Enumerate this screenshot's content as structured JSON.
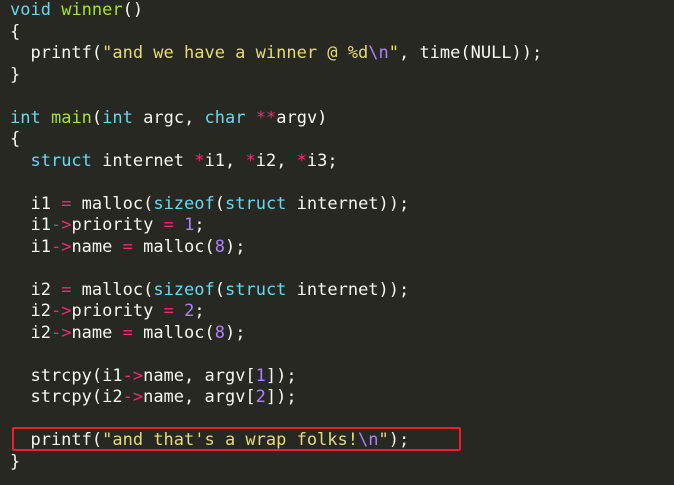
{
  "code_lines": [
    [
      [
        "kw",
        "void"
      ],
      [
        "plain",
        " "
      ],
      [
        "fn",
        "winner"
      ],
      [
        "plain",
        "()"
      ]
    ],
    [
      [
        "plain",
        "{"
      ]
    ],
    [
      [
        "plain",
        "  printf("
      ],
      [
        "str",
        "\"and we have a winner @ %d"
      ],
      [
        "esc",
        "\\n"
      ],
      [
        "str",
        "\""
      ],
      [
        "plain",
        ", time(NULL));"
      ]
    ],
    [
      [
        "plain",
        "}"
      ]
    ],
    [],
    [
      [
        "kw",
        "int"
      ],
      [
        "plain",
        " "
      ],
      [
        "fn",
        "main"
      ],
      [
        "plain",
        "("
      ],
      [
        "kw",
        "int"
      ],
      [
        "plain",
        " argc, "
      ],
      [
        "kw",
        "char"
      ],
      [
        "plain",
        " "
      ],
      [
        "op",
        "**"
      ],
      [
        "plain",
        "argv)"
      ]
    ],
    [
      [
        "plain",
        "{"
      ]
    ],
    [
      [
        "plain",
        "  "
      ],
      [
        "kw",
        "struct"
      ],
      [
        "plain",
        " internet "
      ],
      [
        "op",
        "*"
      ],
      [
        "plain",
        "i1, "
      ],
      [
        "op",
        "*"
      ],
      [
        "plain",
        "i2, "
      ],
      [
        "op",
        "*"
      ],
      [
        "plain",
        "i3;"
      ]
    ],
    [],
    [
      [
        "plain",
        "  i1 "
      ],
      [
        "op",
        "="
      ],
      [
        "plain",
        " malloc("
      ],
      [
        "kw",
        "sizeof"
      ],
      [
        "plain",
        "("
      ],
      [
        "kw",
        "struct"
      ],
      [
        "plain",
        " internet));"
      ]
    ],
    [
      [
        "plain",
        "  i1"
      ],
      [
        "op",
        "->"
      ],
      [
        "plain",
        "priority "
      ],
      [
        "op",
        "="
      ],
      [
        "plain",
        " "
      ],
      [
        "num",
        "1"
      ],
      [
        "plain",
        ";"
      ]
    ],
    [
      [
        "plain",
        "  i1"
      ],
      [
        "op",
        "->"
      ],
      [
        "plain",
        "name "
      ],
      [
        "op",
        "="
      ],
      [
        "plain",
        " malloc("
      ],
      [
        "num",
        "8"
      ],
      [
        "plain",
        ");"
      ]
    ],
    [],
    [
      [
        "plain",
        "  i2 "
      ],
      [
        "op",
        "="
      ],
      [
        "plain",
        " malloc("
      ],
      [
        "kw",
        "sizeof"
      ],
      [
        "plain",
        "("
      ],
      [
        "kw",
        "struct"
      ],
      [
        "plain",
        " internet));"
      ]
    ],
    [
      [
        "plain",
        "  i2"
      ],
      [
        "op",
        "->"
      ],
      [
        "plain",
        "priority "
      ],
      [
        "op",
        "="
      ],
      [
        "plain",
        " "
      ],
      [
        "num",
        "2"
      ],
      [
        "plain",
        ";"
      ]
    ],
    [
      [
        "plain",
        "  i2"
      ],
      [
        "op",
        "->"
      ],
      [
        "plain",
        "name "
      ],
      [
        "op",
        "="
      ],
      [
        "plain",
        " malloc("
      ],
      [
        "num",
        "8"
      ],
      [
        "plain",
        ");"
      ]
    ],
    [],
    [
      [
        "plain",
        "  strcpy(i1"
      ],
      [
        "op",
        "->"
      ],
      [
        "plain",
        "name, argv["
      ],
      [
        "num",
        "1"
      ],
      [
        "plain",
        "]);"
      ]
    ],
    [
      [
        "plain",
        "  strcpy(i2"
      ],
      [
        "op",
        "->"
      ],
      [
        "plain",
        "name, argv["
      ],
      [
        "num",
        "2"
      ],
      [
        "plain",
        "]);"
      ]
    ],
    [],
    [
      [
        "plain",
        "  printf("
      ],
      [
        "str",
        "\"and that's a wrap folks!"
      ],
      [
        "esc",
        "\\n"
      ],
      [
        "str",
        "\""
      ],
      [
        "plain",
        ");"
      ]
    ],
    [
      [
        "plain",
        "}"
      ]
    ]
  ],
  "highlighted_line_index": 20,
  "colors": {
    "background": "#272822",
    "highlight_border": "#e8202a",
    "keyword": "#66d9ef",
    "function": "#a6e22e",
    "string": "#e6db74",
    "number": "#ae81ff",
    "operator": "#f92672",
    "plain": "#f8f8f2"
  }
}
